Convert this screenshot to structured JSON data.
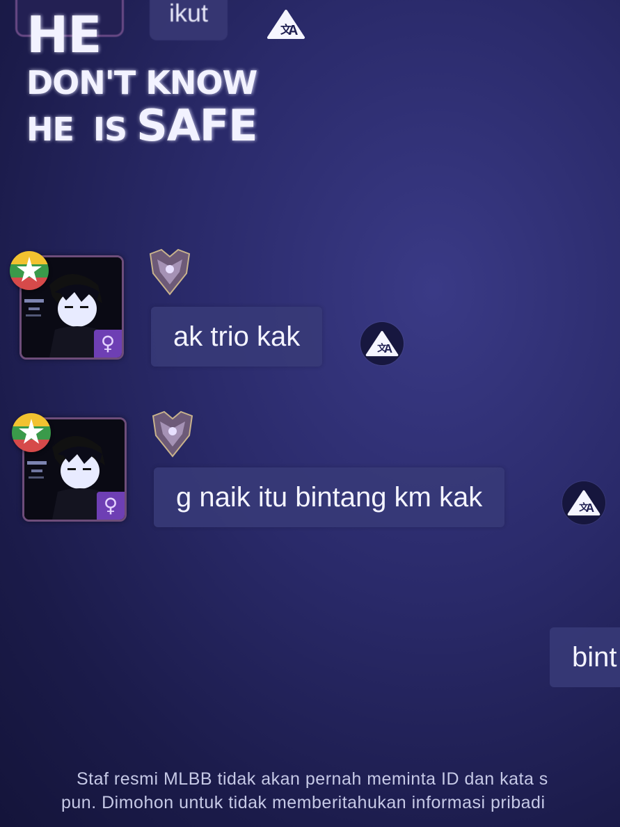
{
  "overlay_caption": {
    "line1": "HE",
    "line2": "DON'T KNOW",
    "line3_a": "HE",
    "line3_b": "IS",
    "line3_c": "SAFE"
  },
  "top_message": {
    "text": "ikut"
  },
  "messages": [
    {
      "text": "ak trio kak",
      "gender_symbol": "♀",
      "flag_icon": "star-flag-icon",
      "rank_icon": "mythic-rank-icon"
    },
    {
      "text": "g naik itu bintang km kak",
      "gender_symbol": "♀",
      "flag_icon": "star-flag-icon",
      "rank_icon": "mythic-rank-icon"
    }
  ],
  "outgoing_message": {
    "text": "bint"
  },
  "notice": {
    "line1": "Staf resmi MLBB tidak akan pernah meminta ID dan kata s",
    "line2": "pun. Dimohon untuk tidak memberitahukan informasi pribadi"
  },
  "colors": {
    "background": "#1f1f52",
    "bubble": "#383a78",
    "avatar_border": "#6e4d7a",
    "gender_badge": "#6e3fb4"
  }
}
